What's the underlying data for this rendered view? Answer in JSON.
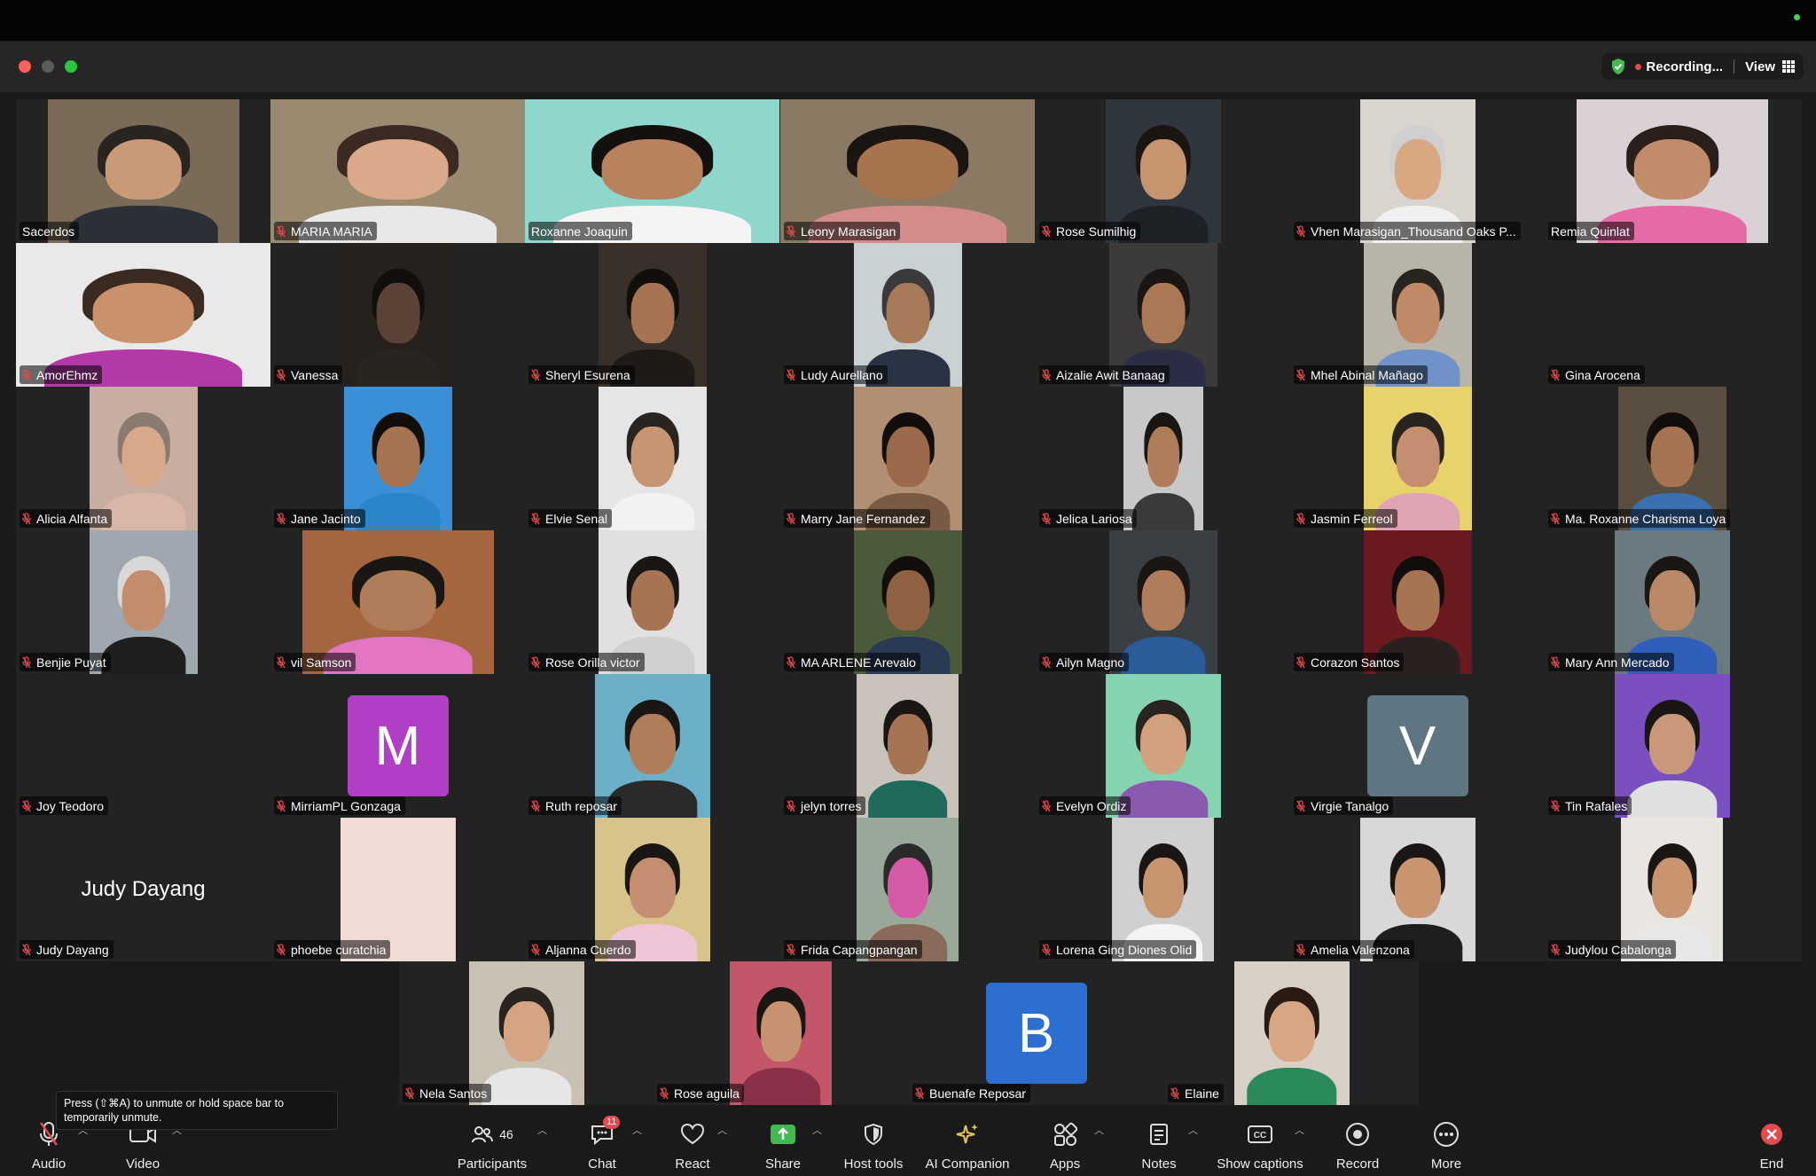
{
  "window": {
    "recording_label": "Recording...",
    "view_label": "View",
    "colors": {
      "recording": "#e5484d",
      "shield": "#3fb950",
      "active_speaker": "#3fb950"
    }
  },
  "participants": [
    {
      "name": "Sacerdos",
      "tile": "photo",
      "muted": false,
      "bg": "#7a6a58",
      "skin": "#c99a78",
      "hair": "#2a2420",
      "shirt": "#2b2f36"
    },
    {
      "name": "MARIA MARIA",
      "tile": "photo",
      "muted": true,
      "bg": "#9a8a70",
      "skin": "#d9a98a",
      "hair": "#3a2a22",
      "shirt": "#e8e8e8"
    },
    {
      "name": "Roxanne Joaquin",
      "tile": "photo",
      "muted": false,
      "active": true,
      "bg": "#8fd6cc",
      "skin": "#b9825e",
      "hair": "#14100e",
      "shirt": "#f4f4f4"
    },
    {
      "name": "Leony Marasigan",
      "tile": "photo",
      "muted": true,
      "bg": "#8a7a64",
      "skin": "#a6744f",
      "hair": "#1b1512",
      "shirt": "#d48c8a"
    },
    {
      "name": "Rose Sumilhig",
      "tile": "photo",
      "muted": true,
      "bg": "#30363d",
      "skin": "#c79470",
      "hair": "#1b1512",
      "shirt": "#1e2226"
    },
    {
      "name": "Vhen Marasigan_Thousand Oaks P...",
      "tile": "photo",
      "muted": true,
      "bg": "#d9d4ce",
      "skin": "#d8a883",
      "hair": "#cfcfcf",
      "shirt": "#f0f0f0"
    },
    {
      "name": "Remia Quinlat",
      "tile": "photo",
      "muted": false,
      "bg": "#d9d1d6",
      "skin": "#c18c6a",
      "hair": "#2a1f1a",
      "shirt": "#e66aa5"
    },
    {
      "name": "AmorEhmz",
      "tile": "photo",
      "muted": true,
      "bg": "#e9e9e9",
      "skin": "#c9926d",
      "hair": "#3a2a22",
      "shirt": "#b13aa8"
    },
    {
      "name": "Vanessa",
      "tile": "photo",
      "muted": true,
      "bg": "#26211c",
      "skin": "#5a4336",
      "hair": "#120e0c",
      "shirt": "#2a2420"
    },
    {
      "name": "Sheryl Esurena",
      "tile": "photo",
      "muted": true,
      "bg": "#3a302a",
      "skin": "#a77453",
      "hair": "#120e0c",
      "shirt": "#1e1a18"
    },
    {
      "name": "Ludy Aurellano",
      "tile": "photo",
      "muted": true,
      "bg": "#c9d1d3",
      "skin": "#a77a5a",
      "hair": "#3a3a3a",
      "shirt": "#2a3344"
    },
    {
      "name": "Aizalie Awit Banaag",
      "tile": "photo",
      "muted": true,
      "bg": "#3d3a3a",
      "skin": "#ab7856",
      "hair": "#1a1614",
      "shirt": "#2a2d44"
    },
    {
      "name": "Mhel Abinal Mañago",
      "tile": "photo",
      "muted": true,
      "bg": "#b9b4a8",
      "skin": "#c08a68",
      "hair": "#2a2420",
      "shirt": "#6f93c8"
    },
    {
      "name": "Gina Arocena",
      "tile": "name",
      "muted": true
    },
    {
      "name": "Alicia Alfanta",
      "tile": "photo",
      "muted": true,
      "bg": "#c7aea0",
      "skin": "#d7a88a",
      "hair": "#8a7a70",
      "shirt": "#d9b6a8"
    },
    {
      "name": "Jane Jacinto",
      "tile": "photo",
      "muted": true,
      "bg": "#3b8fd6",
      "skin": "#a77453",
      "hair": "#120e0c",
      "shirt": "#2a86c8"
    },
    {
      "name": "Elvie Senal",
      "tile": "photo",
      "muted": true,
      "bg": "#e5e5e5",
      "skin": "#c69672",
      "hair": "#2a2420",
      "shirt": "#f2f2f2"
    },
    {
      "name": "Marry Jane Fernandez",
      "tile": "photo",
      "muted": true,
      "bg": "#b28f72",
      "skin": "#9a6a4a",
      "hair": "#120e0c",
      "shirt": "#7a5a44"
    },
    {
      "name": "Jelica Lariosa",
      "tile": "photo",
      "muted": true,
      "bg": "#c8c8c8",
      "skin": "#b07d5a",
      "hair": "#1a1614",
      "shirt": "#3a3a3a"
    },
    {
      "name": "Jasmin Ferreol",
      "tile": "photo",
      "muted": true,
      "bg": "#e7d36a",
      "skin": "#c48f70",
      "hair": "#2a2420",
      "shirt": "#e0a5b4"
    },
    {
      "name": "Ma. Roxanne Charisma Loya",
      "tile": "photo",
      "muted": true,
      "bg": "#5a4e40",
      "skin": "#a77453",
      "hair": "#120e0c",
      "shirt": "#3a6fb0"
    },
    {
      "name": "Benjie Puyat",
      "tile": "photo",
      "muted": true,
      "bg": "#9fa8b0",
      "skin": "#c38d6c",
      "hair": "#d8d8d8",
      "shirt": "#1e1e1e"
    },
    {
      "name": "vil Samson",
      "tile": "photo",
      "muted": true,
      "bg": "#a5653e",
      "skin": "#b07d5a",
      "hair": "#1a1614",
      "shirt": "#e276c3"
    },
    {
      "name": "Rose Orilla victor",
      "tile": "photo",
      "muted": true,
      "bg": "#e0e0e0",
      "skin": "#a77453",
      "hair": "#1a1614",
      "shirt": "#cfcfcf"
    },
    {
      "name": "MA ARLENE Arevalo",
      "tile": "photo",
      "muted": true,
      "bg": "#4a5a3a",
      "skin": "#8f6244",
      "hair": "#120e0c",
      "shirt": "#2a3a55"
    },
    {
      "name": "Ailyn Magno",
      "tile": "photo",
      "muted": true,
      "bg": "#3a3f44",
      "skin": "#b07d5a",
      "hair": "#1a1614",
      "shirt": "#2a5c9a"
    },
    {
      "name": "Corazon Santos",
      "tile": "photo",
      "muted": true,
      "bg": "#6a1a1e",
      "skin": "#a77453",
      "hair": "#120e0c",
      "shirt": "#2a2020"
    },
    {
      "name": "Mary Ann Mercado",
      "tile": "photo",
      "muted": true,
      "bg": "#6a7a80",
      "skin": "#b98866",
      "hair": "#1a1614",
      "shirt": "#2f5fb8"
    },
    {
      "name": "Joy Teodoro",
      "tile": "name",
      "muted": true
    },
    {
      "name": "MirriamPL Gonzaga",
      "tile": "avatar",
      "muted": true,
      "letter": "M",
      "color": "#b03fc6"
    },
    {
      "name": "Ruth reposar",
      "tile": "photo",
      "muted": true,
      "bg": "#6ab0c8",
      "skin": "#b07d5a",
      "hair": "#1a1614",
      "shirt": "#2a2a2a"
    },
    {
      "name": "jelyn torres",
      "tile": "photo",
      "muted": true,
      "bg": "#c9c3bc",
      "skin": "#a77453",
      "hair": "#1a1614",
      "shirt": "#1f6a5a"
    },
    {
      "name": "Evelyn Ordiz",
      "tile": "photo",
      "muted": true,
      "bg": "#86d3b0",
      "skin": "#d1a07c",
      "hair": "#2a2420",
      "shirt": "#8a5ab0"
    },
    {
      "name": "Virgie Tanalgo",
      "tile": "avatar",
      "muted": true,
      "letter": "V",
      "color": "#5f7582"
    },
    {
      "name": "Tin Rafales",
      "tile": "photo",
      "muted": true,
      "bg": "#7a4fc0",
      "skin": "#c9977a",
      "hair": "#1a1614",
      "shirt": "#e0e0e0"
    },
    {
      "name": "Judy Dayang",
      "tile": "name",
      "muted": true,
      "display_name": "Judy Dayang"
    },
    {
      "name": "phoebe curatchia",
      "tile": "photo",
      "muted": true,
      "bg": "#f0dcd4",
      "skin": "#f0dcd4",
      "hair": "#f0dcd4",
      "shirt": "#f0dcd4"
    },
    {
      "name": "Aljanna Cuerdo",
      "tile": "photo",
      "muted": true,
      "bg": "#d8c48a",
      "skin": "#c48f70",
      "hair": "#1a1614",
      "shirt": "#efc6d8"
    },
    {
      "name": "Frida Capangpangan",
      "tile": "photo",
      "muted": true,
      "bg": "#9aa89a",
      "skin": "#d45aa6",
      "hair": "#2a2a2a",
      "shirt": "#8a6a5a"
    },
    {
      "name": "Lorena Ging Diones Olid",
      "tile": "photo",
      "muted": true,
      "bg": "#d0d0d0",
      "skin": "#c79470",
      "hair": "#1a1614",
      "shirt": "#f4f4f4"
    },
    {
      "name": "Amelia Valenzona",
      "tile": "photo",
      "muted": true,
      "bg": "#d8d8d8",
      "skin": "#c99570",
      "hair": "#1a1614",
      "shirt": "#1e1e1e"
    },
    {
      "name": "Judylou Cabalonga",
      "tile": "photo",
      "muted": true,
      "bg": "#e9e6e2",
      "skin": "#c99570",
      "hair": "#1a1614",
      "shirt": "#e8e8e8"
    },
    {
      "name": "Nela Santos",
      "tile": "photo",
      "muted": true,
      "bg": "#c9c1b4",
      "skin": "#d5a483",
      "hair": "#2a2420",
      "shirt": "#e6e6e6"
    },
    {
      "name": "Rose aguila",
      "tile": "photo",
      "muted": true,
      "bg": "#c4566a",
      "skin": "#c69270",
      "hair": "#1a1614",
      "shirt": "#8a3048"
    },
    {
      "name": "Buenafe Reposar",
      "tile": "avatar",
      "muted": true,
      "letter": "B",
      "color": "#2d6fd1"
    },
    {
      "name": "Elaine",
      "tile": "photo",
      "muted": true,
      "bg": "#d8d0c4",
      "skin": "#d7a684",
      "hair": "#2a1a14",
      "shirt": "#2a8a5a"
    }
  ],
  "tooltip": "Press (⇧⌘A) to unmute or hold space bar to temporarily unmute.",
  "toolbar": {
    "audio": "Audio",
    "video": "Video",
    "participants": "Participants",
    "participants_count": "46",
    "chat": "Chat",
    "chat_badge": "11",
    "react": "React",
    "share": "Share",
    "host_tools": "Host tools",
    "ai_companion": "AI Companion",
    "apps": "Apps",
    "notes": "Notes",
    "show_captions": "Show captions",
    "record": "Record",
    "more": "More",
    "end": "End",
    "colors": {
      "share": "#3fb950",
      "end": "#e5484d"
    }
  }
}
